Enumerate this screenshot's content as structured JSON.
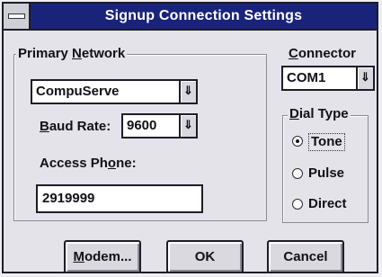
{
  "window": {
    "title": "Signup Connection Settings"
  },
  "primary_network": {
    "legend_pre": "Primary ",
    "legend_key": "N",
    "legend_post": "etwork",
    "network_value": "CompuServe",
    "baud_label_key": "B",
    "baud_label_post": "aud Rate:",
    "baud_value": "9600",
    "phone_label_pre": "Access Ph",
    "phone_label_key": "o",
    "phone_label_post": "ne:",
    "phone_value": "2919999"
  },
  "connector": {
    "label_key": "C",
    "label_post": "onnector",
    "value": "COM1"
  },
  "dial_type": {
    "legend_key": "D",
    "legend_post": "ial Type",
    "options": [
      {
        "label": "Tone",
        "selected": true
      },
      {
        "label": "Pulse",
        "selected": false
      },
      {
        "label": "Direct",
        "selected": false
      }
    ]
  },
  "buttons": {
    "modem_key": "M",
    "modem_post": "odem...",
    "ok_label": "OK",
    "cancel_label": "Cancel"
  },
  "icons": {
    "dropdown_arrow": "⇓"
  }
}
